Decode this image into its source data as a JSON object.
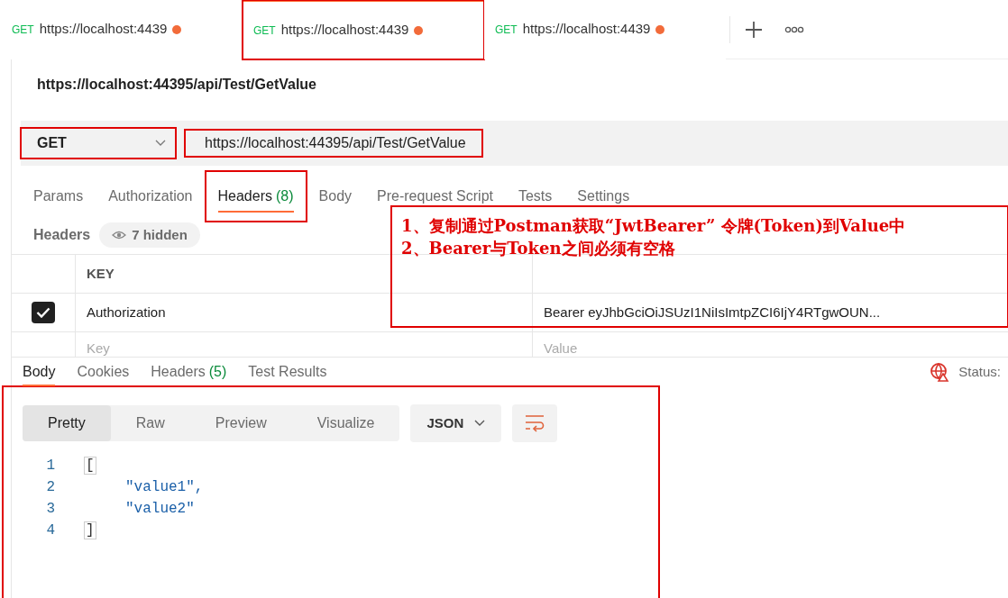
{
  "tabs": [
    {
      "method": "GET",
      "url": "https://localhost:4439",
      "unsaved": true,
      "selected": false,
      "highlighted": false
    },
    {
      "method": "GET",
      "url": "https://localhost:4439",
      "unsaved": true,
      "selected": true,
      "highlighted": true
    },
    {
      "method": "GET",
      "url": "https://localhost:4439",
      "unsaved": true,
      "selected": false,
      "highlighted": false
    }
  ],
  "request_title": "https://localhost:44395/api/Test/GetValue",
  "method": {
    "value": "GET",
    "highlighted": true
  },
  "url": {
    "value": "https://localhost:44395/api/Test/GetValue",
    "highlighted": true
  },
  "request_tabs": [
    {
      "label": "Params",
      "selected": false,
      "highlighted": false
    },
    {
      "label": "Authorization",
      "selected": false,
      "highlighted": false
    },
    {
      "label": "Headers",
      "count": "(8)",
      "selected": true,
      "highlighted": true
    },
    {
      "label": "Body",
      "selected": false,
      "highlighted": false
    },
    {
      "label": "Pre-request Script",
      "selected": false,
      "highlighted": false
    },
    {
      "label": "Tests",
      "selected": false,
      "highlighted": false
    },
    {
      "label": "Settings",
      "selected": false,
      "highlighted": false
    }
  ],
  "headers_label": "Headers",
  "hidden_count": "7 hidden",
  "table": {
    "columns": [
      "KEY"
    ],
    "rows": [
      {
        "checked": true,
        "key": "Authorization",
        "value": "Bearer eyJhbGciOiJSUzI1NiIsImtpZCI6IjY4RTgwOUN..."
      }
    ],
    "new_row": {
      "key": {
        "placeholder": "Key"
      },
      "value": {
        "placeholder": "Value"
      }
    }
  },
  "response_tabs": [
    {
      "label": "Body",
      "selected": true
    },
    {
      "label": "Cookies",
      "selected": false
    },
    {
      "label": "Headers",
      "count": "(5)",
      "selected": false
    },
    {
      "label": "Test Results",
      "selected": false
    }
  ],
  "status_label": "Status:",
  "view_modes": [
    {
      "label": "Pretty",
      "selected": true
    },
    {
      "label": "Raw",
      "selected": false
    },
    {
      "label": "Preview",
      "selected": false
    },
    {
      "label": "Visualize",
      "selected": false
    }
  ],
  "format": "JSON",
  "response_highlighted": true,
  "code_lines": [
    {
      "number": "1",
      "text": "[",
      "kind": "punct"
    },
    {
      "number": "2",
      "text": "\"value1\",",
      "kind": "string"
    },
    {
      "number": "3",
      "text": "\"value2\"",
      "kind": "string"
    },
    {
      "number": "4",
      "text": "]",
      "kind": "punct"
    }
  ],
  "annotation": {
    "lines": [
      "1、复制通过Postman获取“JwtBearer” 令牌(Token)到Value中",
      "2、Bearer与Token之间必须有空格"
    ]
  }
}
